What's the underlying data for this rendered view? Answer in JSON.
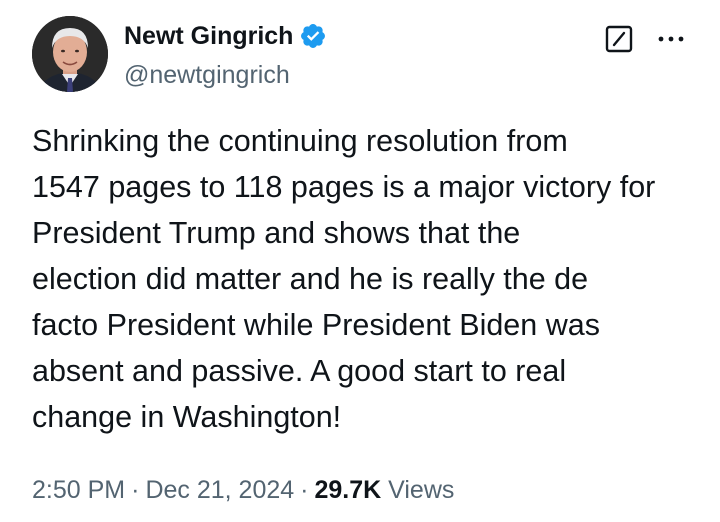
{
  "author": {
    "display_name": "Newt Gingrich",
    "handle": "@newtgingrich",
    "verified": true,
    "verified_color": "#1d9bf0"
  },
  "icons": {
    "grok": "grok-icon",
    "more": "more-icon",
    "verified": "verified-badge-icon"
  },
  "tweet": {
    "lines": [
      "Shrinking the continuing resolution from",
      "1547 pages to 118 pages is a major victory for",
      "President Trump and shows that the",
      "election did matter and he is really the de",
      "facto President while President Biden was",
      "absent and passive. A good start to real",
      "change in Washington!"
    ]
  },
  "meta": {
    "time": "2:50 PM",
    "separator": "·",
    "date": "Dec 21, 2024",
    "views_count": "29.7K",
    "views_label": "Views"
  },
  "colors": {
    "text_primary": "#0f1419",
    "text_secondary": "#536471"
  }
}
